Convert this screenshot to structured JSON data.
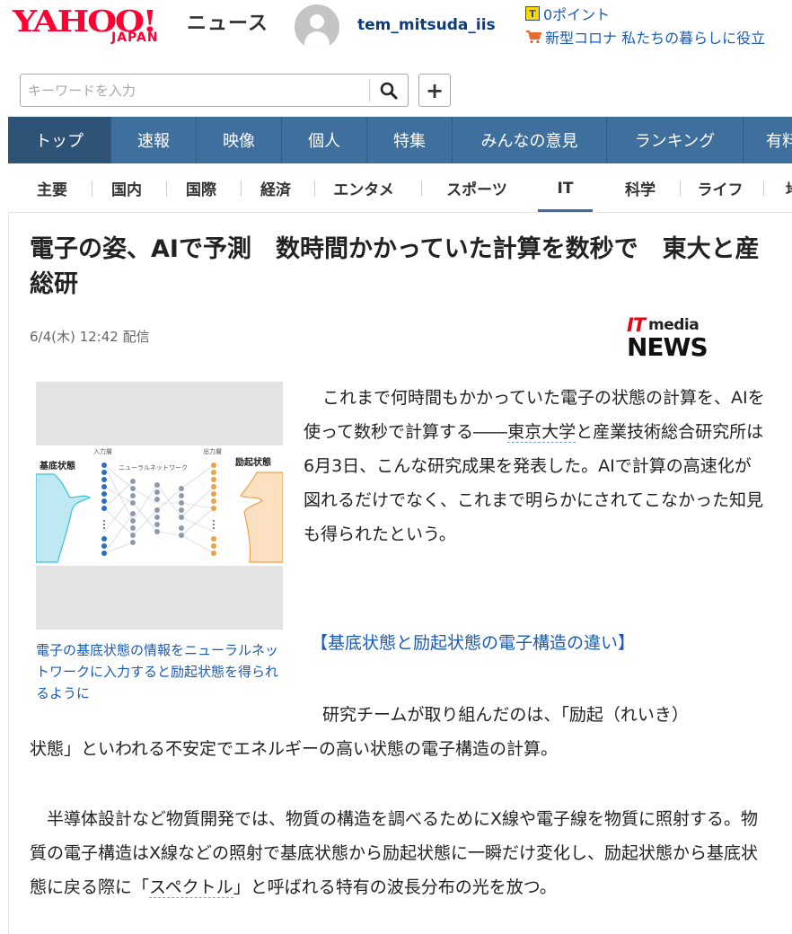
{
  "header": {
    "logo_main": "YAHOO!",
    "logo_sub": "JAPAN",
    "logo_news": "ニュース",
    "username": "tem_mitsuda_iis",
    "points_text": "0ポイント",
    "corona_text": "新型コロナ 私たちの暮らしに役立"
  },
  "search": {
    "placeholder": "キーワードを入力",
    "add_label": "+"
  },
  "main_nav": {
    "items": [
      "トップ",
      "速報",
      "映像",
      "個人",
      "特集",
      "みんなの意見",
      "ランキング",
      "有料"
    ],
    "active": "トップ"
  },
  "sub_nav": {
    "items": [
      "主要",
      "国内",
      "国際",
      "経済",
      "エンタメ",
      "スポーツ",
      "IT",
      "科学",
      "ライフ",
      "地域"
    ],
    "active": "IT"
  },
  "article": {
    "headline": "電子の姿、AIで予測　数時間かかっていた計算を数秒で　東大と産総研",
    "date": "6/4(木) 12:42 配信",
    "source_logo_it": "IT",
    "source_logo_media": "media",
    "source_logo_news": "NEWS",
    "figure": {
      "label_input_layer": "入力層",
      "label_output_layer": "出力層",
      "label_network": "ニューラルネットワーク",
      "label_ground": "基底状態",
      "label_excited": "励起状態"
    },
    "caption": "電子の基底状態の情報をニューラルネットワークに入力すると励起状態を得られるように",
    "p1_before_link": "これまで何時間もかかっていた電子の状態の計算を、AIを使って数秒で計算する――",
    "p1_link": "東京大学",
    "p1_after_link": "と産業技術総合研究所は6月3日、こんな研究成果を発表した。AIで計算の高速化が図れるだけでなく、これまで明らかにされてこなかった知見も得られたという。",
    "subhead": "【基底状態と励起状態の電子構造の違い】",
    "p2_line1": "研究チームが取り組んだのは、「励起（れいき）",
    "p2_line2": "状態」といわれる不安定でエネルギーの高い状態の電子構造の計算。",
    "p3_before_link": "　半導体設計など物質開発では、物質の構造を調べるためにX線や電子線を物質に照射する。物質の電子構造はX線などの照射で基底状態から励起状態に一瞬だけ変化し、励起状態から基底状態に戻る際に「",
    "p3_link": "スペクトル",
    "p3_after_link": "」と呼ばれる特有の波長分布の光を放つ。"
  },
  "colors": {
    "brand_red": "#ff0033",
    "nav_blue": "#3f6f9c",
    "nav_active": "#2f5377",
    "link_blue": "#1a5bb5"
  }
}
